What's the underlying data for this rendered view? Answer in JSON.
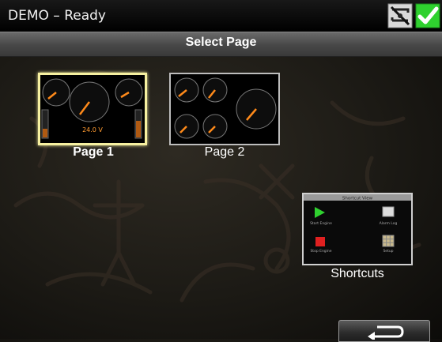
{
  "window": {
    "title": "DEMO – Ready"
  },
  "status_icons": [
    "network-disconnected-icon",
    "check-icon"
  ],
  "header": {
    "title": "Select Page"
  },
  "pages": [
    {
      "label": "Page 1",
      "selected": true
    },
    {
      "label": "Page 2",
      "selected": false
    }
  ],
  "shortcuts": {
    "label": "Shortcuts",
    "panel_title": "Shortcut View",
    "items": [
      {
        "label": "Start Engine",
        "icon": "play-icon"
      },
      {
        "label": "Alarm Log",
        "icon": "bell-icon"
      },
      {
        "label": "Stop Engine",
        "icon": "stop-icon"
      },
      {
        "label": "Setup",
        "icon": "grid-icon"
      }
    ]
  },
  "page1_readout": "24.0 V",
  "back_button": {
    "icon": "back-arrow-icon"
  },
  "colors": {
    "accent_green": "#2fd12f",
    "selected_border": "#f6f0a0",
    "needle": "#ff8a1a"
  }
}
